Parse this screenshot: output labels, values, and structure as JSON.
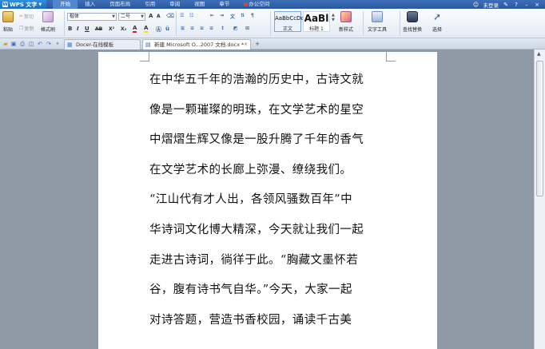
{
  "app": {
    "name": "WPS 文字",
    "logo_letter": "W",
    "menu": [
      {
        "label": "开始",
        "active": true
      },
      {
        "label": "插入",
        "active": false
      },
      {
        "label": "页面布局",
        "active": false
      },
      {
        "label": "引用",
        "active": false
      },
      {
        "label": "审阅",
        "active": false
      },
      {
        "label": "视图",
        "active": false
      },
      {
        "label": "章节",
        "active": false
      },
      {
        "label": "办公空间",
        "active": false
      }
    ],
    "login_label": "未登录",
    "help_icon": "?",
    "min_icon": "–",
    "close_icon": "×"
  },
  "ribbon": {
    "paste_label": "粘贴",
    "cut_label": "剪切",
    "copy_label": "复制",
    "format_painter_label": "格式刷",
    "font_name": "楷体",
    "font_size": "二号",
    "font_size_increase": "A",
    "font_size_decrease": "A",
    "bold": "B",
    "italic": "I",
    "underline": "U",
    "strike": "AB",
    "superscript": "X²",
    "subscript": "X₂",
    "font_color": "A",
    "highlight": "A",
    "styles": [
      {
        "sample": "AaBbCcDd",
        "label": "正文"
      },
      {
        "sample": "AaBl",
        "label": "标题 1"
      }
    ],
    "new_style_label": "新样式",
    "text_tools_label": "文字工具",
    "find_replace_label": "查找替换",
    "select_label": "选择"
  },
  "tabs": [
    {
      "label": "Docer-在线模板",
      "active": false
    },
    {
      "label": "新建 Microsoft O...2007 文档.docx *",
      "active": true
    }
  ],
  "add_tab": "+",
  "document": {
    "lines": [
      "在中华五千年的浩瀚的历史中，古诗文就",
      "像是一颗璀璨的明珠，在文学艺术的星空",
      "中熠熠生辉又像是一股升腾了千年的香气",
      "在文学艺术的长廊上弥漫、缭绕我们。",
      "“江山代有才人出，各领风骚数百年”中",
      "华诗词文化博大精深，今天就让我们一起",
      "走进古诗词，徜徉于此。“胸藏文墨怀若",
      "谷，腹有诗书气自华。”今天，大家一起",
      "对诗答题，营造书香校园，诵读千古美"
    ]
  }
}
